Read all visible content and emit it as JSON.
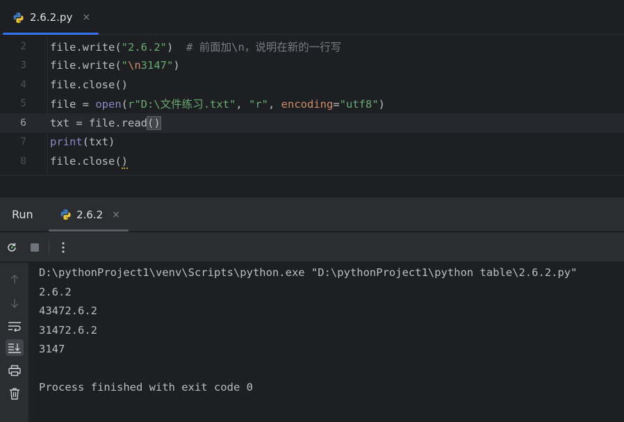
{
  "editor_tab": {
    "filename": "2.6.2.py",
    "close": "×"
  },
  "editor": {
    "lines": [
      {
        "num": "2",
        "segments": [
          "file.write(",
          "\"2.6.2\"",
          ")  ",
          "# 前面加\\n，说明在新的一行写"
        ]
      },
      {
        "num": "3",
        "segments": [
          "file.write(",
          "\"",
          "\\n",
          "3147\"",
          ")"
        ]
      },
      {
        "num": "4",
        "segments": [
          "file.close()"
        ]
      },
      {
        "num": "5",
        "segments": [
          "file = ",
          "open",
          "(",
          "r\"D:\\文件练习.txt\"",
          ", ",
          "\"r\"",
          ", ",
          "encoding",
          "=",
          "\"utf8\"",
          ")"
        ]
      },
      {
        "num": "6",
        "segments": [
          "txt = file.read",
          "()"
        ]
      },
      {
        "num": "7",
        "segments": [
          "print",
          "(txt)"
        ]
      },
      {
        "num": "8",
        "segments": [
          "file.close(",
          ")"
        ]
      }
    ]
  },
  "run_panel": {
    "title": "Run",
    "tab_label": "2.6.2",
    "tab_close": "×",
    "console_lines": [
      "D:\\pythonProject1\\venv\\Scripts\\python.exe \"D:\\pythonProject1\\python table\\2.6.2.py\"",
      "2.6.2",
      "43472.6.2",
      "31472.6.2",
      "3147",
      "",
      "Process finished with exit code 0"
    ]
  },
  "colors": {
    "accent": "#3574f0",
    "string": "#6aab73",
    "keyword_arg": "#cf8e6d",
    "builtin": "#8888c6",
    "comment": "#7a7e85"
  },
  "icons": {
    "toolbar": [
      "rerun-icon",
      "stop-icon",
      "more-options-icon"
    ],
    "rail": [
      "arrow-up-icon",
      "arrow-down-icon",
      "soft-wrap-icon",
      "scroll-to-end-icon",
      "print-icon",
      "trash-icon"
    ]
  }
}
